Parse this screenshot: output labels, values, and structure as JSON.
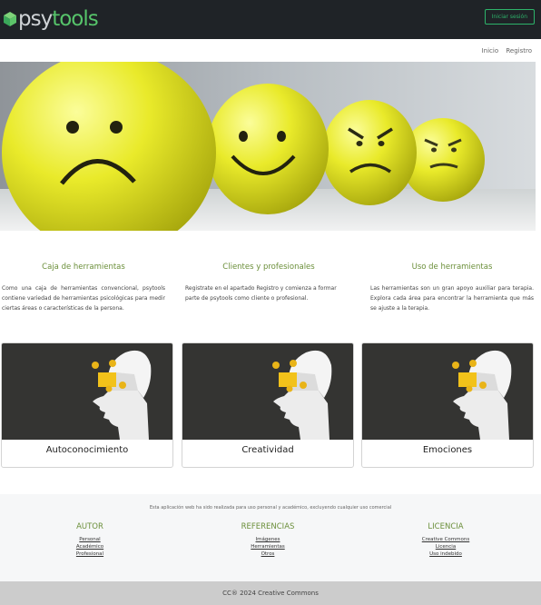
{
  "brand": {
    "logo_left": "psy",
    "logo_right": "tools"
  },
  "header": {
    "login_label": "Iniciar sesión"
  },
  "nav": {
    "inicio": "Inicio",
    "registro": "Registro"
  },
  "sections": [
    {
      "title": "Caja de herramientas",
      "text": "Como una caja de herramientas convencional, psytools contiene variedad de herramientas psicológicas para medir ciertas áreas o características de la persona."
    },
    {
      "title": "Clientes y profesionales",
      "text": "Registrate en el apartado Registro y comienza a formar parte de psytools como cliente o profesional."
    },
    {
      "title": "Uso de herramientas",
      "text": "Las herramientas son un gran apoyo auxiliar para terapia. Explora cada área para encontrar la herramienta que más se ajuste a la terapia."
    }
  ],
  "cards": [
    {
      "title": "Autoconocimiento"
    },
    {
      "title": "Creatividad"
    },
    {
      "title": "Emociones"
    }
  ],
  "footer": {
    "note": "Esta aplicación web ha sido realizada para uso personal y académico, excluyendo cualquier uso comercial",
    "cols": [
      {
        "title": "AUTOR",
        "links": [
          "Personal",
          "Académico",
          "Profesional"
        ]
      },
      {
        "title": "REFERENCIAS",
        "links": [
          "Imágenes",
          "Herramientas",
          "Otros"
        ]
      },
      {
        "title": "LICENCIA",
        "links": [
          "Creative Commons",
          "Licencia",
          "Uso indebido"
        ]
      }
    ],
    "copyright": "CC® 2024 Creative Commons"
  }
}
